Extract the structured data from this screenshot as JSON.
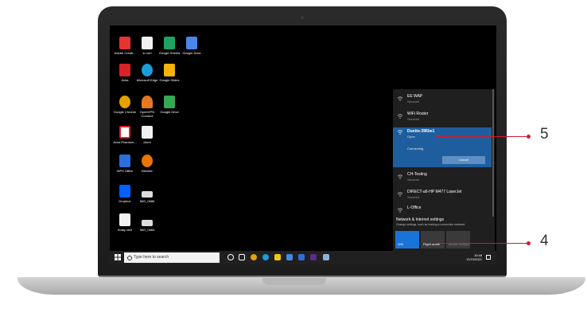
{
  "desktop_icons": [
    {
      "label": "Adobe Creati...",
      "icon": "adobe-cc-icon",
      "color": "#e5352f"
    },
    {
      "label": "to sort",
      "icon": "file-icon",
      "color": "#f1f1f1"
    },
    {
      "label": "Google Sheets",
      "icon": "google-sheets-icon",
      "color": "#1ea362"
    },
    {
      "label": "Google Docs",
      "icon": "google-docs-icon",
      "color": "#4a86e8"
    },
    {
      "label": "Avira",
      "icon": "avira-icon",
      "color": "#d8232a"
    },
    {
      "label": "Microsoft Edge",
      "icon": "edge-icon",
      "color": "#1a9dd9"
    },
    {
      "label": "Google Slides",
      "icon": "google-slides-icon",
      "color": "#f4b400"
    },
    {
      "label": "Google Chrome",
      "icon": "chrome-icon",
      "color": "#e5a100"
    },
    {
      "label": "OpenVPN Connect",
      "icon": "openvpn-icon",
      "color": "#e87722"
    },
    {
      "label": "Google Drive",
      "icon": "google-drive-icon",
      "color": "#34a853"
    },
    {
      "label": "Avira Phantom...",
      "icon": "avira-phantom-icon",
      "color": "#d8232a"
    },
    {
      "label": "client",
      "icon": "file-icon",
      "color": "#f1f1f1"
    },
    {
      "label": "WPS Office",
      "icon": "wps-office-icon",
      "color": "#2d6ed8"
    },
    {
      "label": "Blender",
      "icon": "blender-icon",
      "color": "#ea7600"
    },
    {
      "label": "Dropbox",
      "icon": "dropbox-icon",
      "color": "#0061fe"
    },
    {
      "label": "IMG_0686",
      "icon": "image-file-icon",
      "color": "#cccccc"
    },
    {
      "label": "friday visit",
      "icon": "file-icon",
      "color": "#f1f1f1"
    },
    {
      "label": "IMG_0684",
      "icon": "image-file-icon",
      "color": "#cccccc"
    }
  ],
  "taskbar": {
    "search_placeholder": "Type here to search",
    "time": "10:48",
    "date": "11/10/2021"
  },
  "network_panel": {
    "networks": [
      {
        "name": "EE WAP",
        "status": "Secured"
      },
      {
        "name": "WiFi Router",
        "status": "Secured"
      },
      {
        "name": "Duetto-396be1",
        "status": "Open",
        "state": "Connecting",
        "cancel": "Cancel"
      },
      {
        "name": "CH-Testing",
        "status": "Secured"
      },
      {
        "name": "DIRECT-a6-HP M477 LaserJet",
        "status": "Secured"
      },
      {
        "name": "L-Office",
        "status": ""
      }
    ],
    "settings_title": "Network & Internet settings",
    "settings_subtitle": "Change settings, such as making a connection metered.",
    "tiles": [
      {
        "label": "Wifi",
        "color": "#1a73d9"
      },
      {
        "label": "Flight mode",
        "color": "#3a3a3a"
      },
      {
        "label": "Mobile hotspot",
        "color": "#3a3a3a"
      }
    ]
  },
  "callouts": {
    "c5": "5",
    "c4": "4",
    "color": "#d21a2f"
  }
}
